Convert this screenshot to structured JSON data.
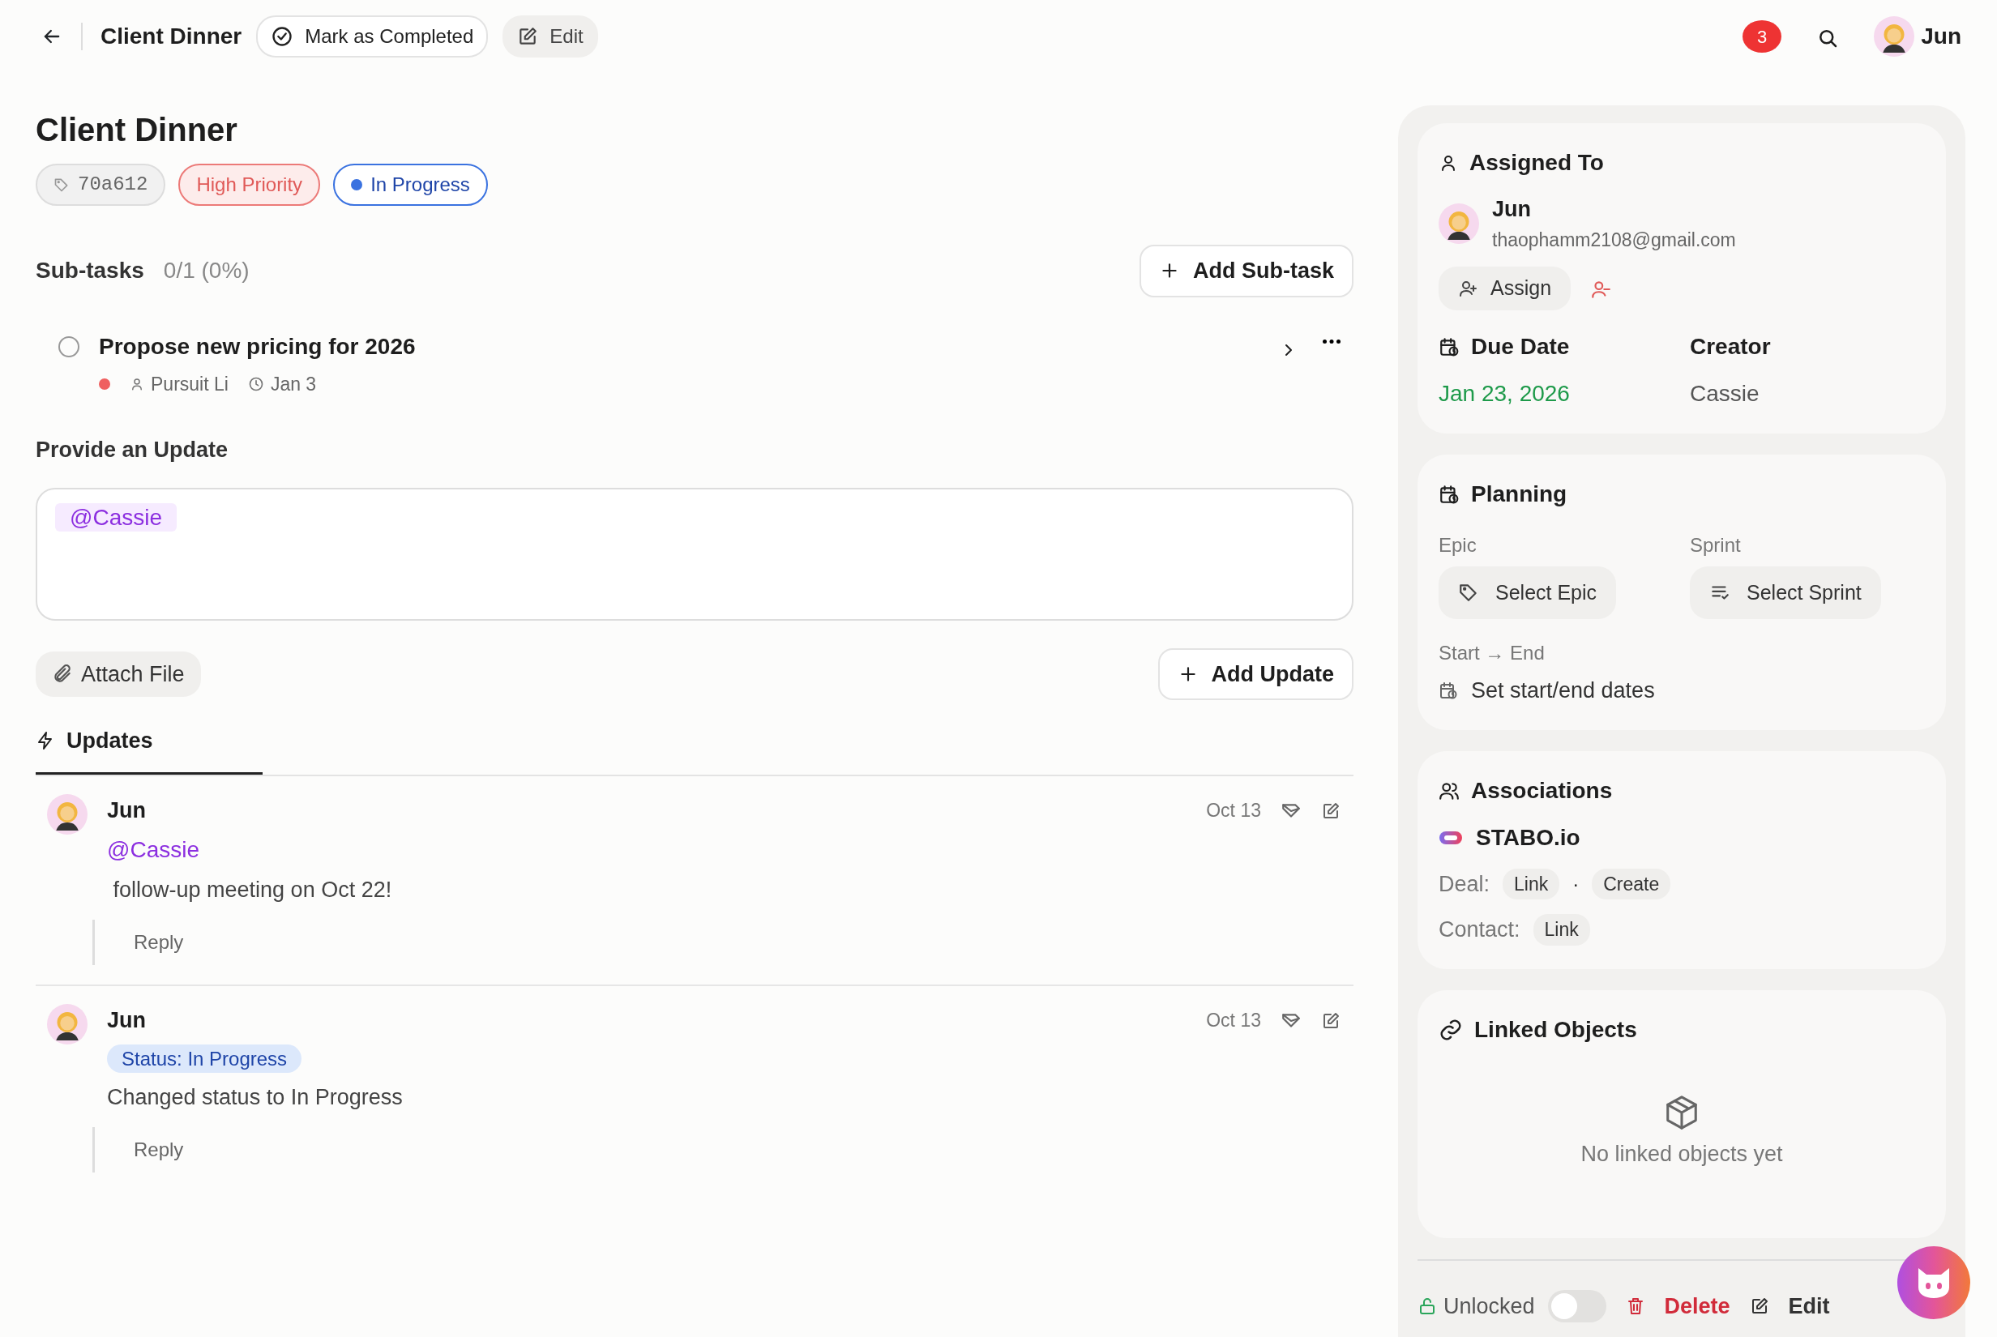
{
  "header": {
    "title": "Client Dinner",
    "buttons": [
      {
        "label": "Mark as Completed",
        "kind": "outline"
      },
      {
        "label": "Edit",
        "kind": "ghost"
      }
    ],
    "notification_count": "3",
    "user": "Jun"
  },
  "task": {
    "title": "Client Dinner",
    "tags": [
      {
        "label": "70a612",
        "kind": "id"
      },
      {
        "label": "High Priority",
        "kind": "priority"
      },
      {
        "label": "In Progress",
        "kind": "status"
      }
    ]
  },
  "subtasks": {
    "title": "Sub-tasks",
    "progress": "0/1 (0%)",
    "add_button": "Add Sub-task",
    "items": [
      {
        "title": "Propose new pricing for 2026",
        "checked": false,
        "color": "#ef6060",
        "assignee": "Pursuit Li",
        "due": "Jan 3"
      }
    ]
  },
  "update_form": {
    "label": "Provide an Update",
    "mention": "@Cassie",
    "attach_button": "Attach File",
    "add_button": "Add Update"
  },
  "tabs": [
    {
      "label": "Updates",
      "selected": true
    }
  ],
  "updates": [
    {
      "author": "Jun",
      "date": "Oct 13",
      "kind": "mention",
      "tag": "@Cassie",
      "text": " follow-up meeting on Oct 22!",
      "reply": "Reply"
    },
    {
      "author": "Jun",
      "date": "Oct 13",
      "kind": "status",
      "tag": "Status: In Progress",
      "text": "Changed status to In Progress",
      "reply": "Reply"
    }
  ],
  "sidebar": {
    "assigned": {
      "title": "Assigned To",
      "name": "Jun",
      "email": "thaophamm2108@gmail.com",
      "assign_button": "Assign",
      "due_label": "Due Date",
      "due_value": "Jan 23, 2026",
      "creator_label": "Creator",
      "creator_value": "Cassie"
    },
    "planning": {
      "title": "Planning",
      "epic_label": "Epic",
      "epic_button": "Select Epic",
      "sprint_label": "Sprint",
      "sprint_button": "Select Sprint",
      "range_label": "Start → End",
      "range_button": "Set start/end dates"
    },
    "associations": {
      "title": "Associations",
      "company": "STABO.io",
      "separator": "·",
      "rows": [
        {
          "label": "Deal:",
          "actions": [
            "Link",
            "Create"
          ]
        },
        {
          "label": "Contact:",
          "actions": [
            "Link"
          ]
        }
      ]
    },
    "linked": {
      "title": "Linked Objects",
      "empty_text": "No linked objects yet"
    },
    "footer": {
      "lock_label": "Unlocked",
      "locked": false,
      "delete": "Delete",
      "edit": "Edit"
    }
  }
}
